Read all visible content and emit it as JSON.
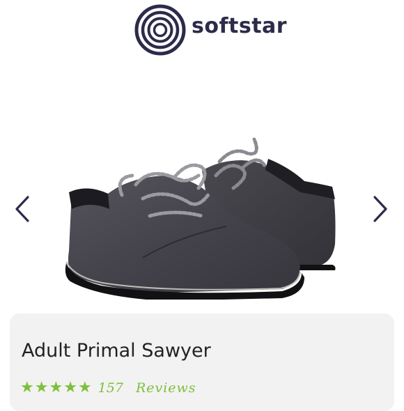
{
  "brand": {
    "name": "softstar",
    "logo_icon": "concentric-circles-logo",
    "color": "#2c2b4a"
  },
  "carousel": {
    "prev_icon": "chevron-left-icon",
    "next_icon": "chevron-right-icon",
    "image": "pair of dark grey suede lace-up shoes"
  },
  "product": {
    "title": "Adult Primal Sawyer",
    "rating": {
      "stars": 5,
      "max": 5,
      "count": "157",
      "label": "Reviews",
      "color": "#7dbf3a"
    }
  }
}
